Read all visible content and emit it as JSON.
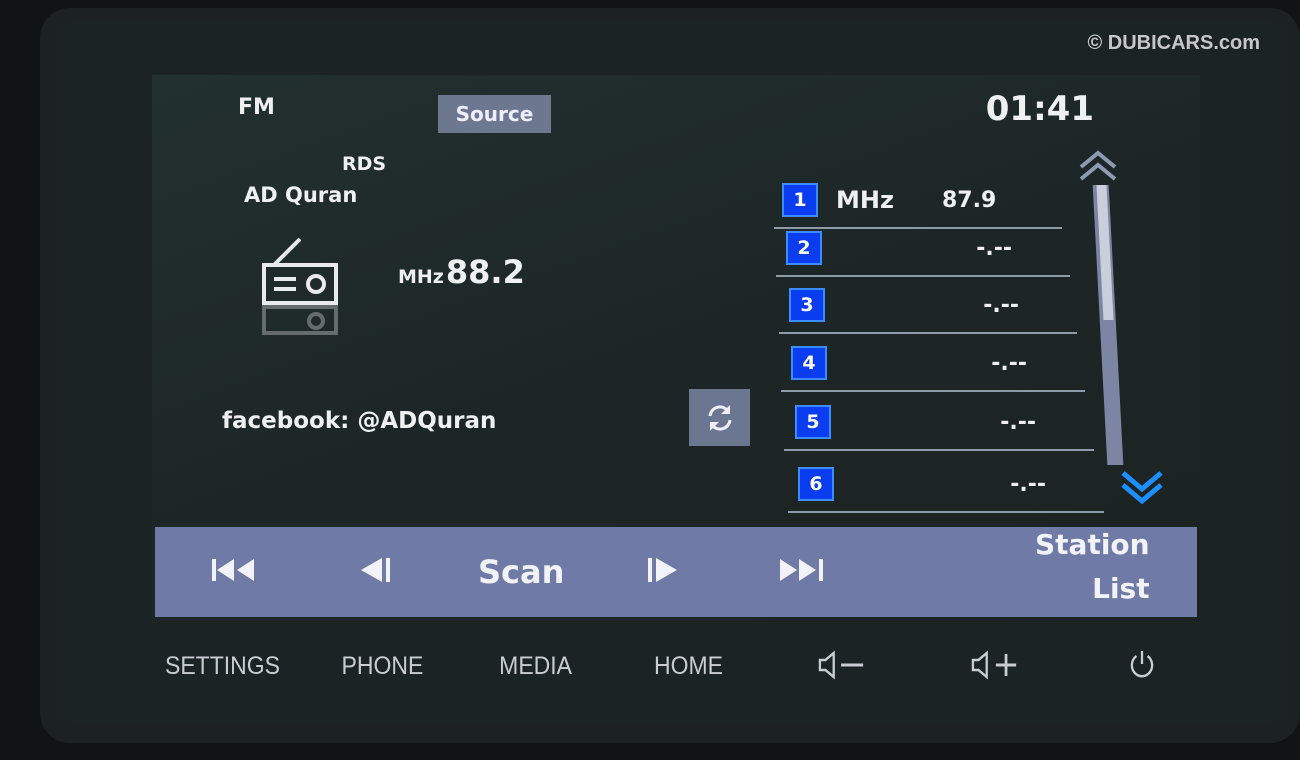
{
  "watermark": "© DUBICARS.com",
  "header": {
    "band": "FM",
    "source_label": "Source",
    "clock": "01:41"
  },
  "now_playing": {
    "rds_label": "RDS",
    "station_name": "AD Quran",
    "frequency_unit": "MHz",
    "frequency": "88.2",
    "radio_text": "facebook: @ADQuran",
    "icon": "radio-icon"
  },
  "presets": [
    {
      "number": "1",
      "unit": "MHz",
      "frequency": "87.9"
    },
    {
      "number": "2",
      "unit": "",
      "frequency": "-.--"
    },
    {
      "number": "3",
      "unit": "",
      "frequency": "-.--"
    },
    {
      "number": "4",
      "unit": "",
      "frequency": "-.--"
    },
    {
      "number": "5",
      "unit": "",
      "frequency": "-.--"
    },
    {
      "number": "6",
      "unit": "",
      "frequency": "-.--"
    }
  ],
  "controls": {
    "scan_label": "Scan",
    "station_list_line1": "Station",
    "station_list_line2": "List"
  },
  "hardware_keys": {
    "settings": "SETTINGS",
    "phone": "PHONE",
    "media": "MEDIA",
    "home": "HOME"
  },
  "colors": {
    "preset_badge": "#0a3cf0",
    "control_bar": "#707aa6",
    "scroll_down_accent": "#1e8fff"
  }
}
